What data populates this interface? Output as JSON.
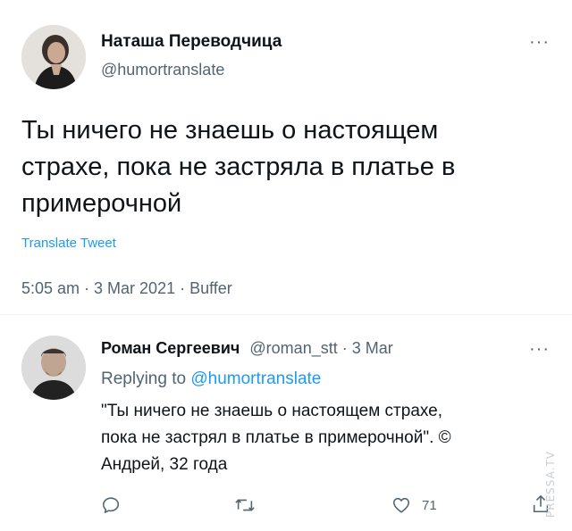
{
  "main_tweet": {
    "display_name": "Наташа Переводчица",
    "handle": "@humortranslate",
    "more_icon": "ellipsis-icon",
    "text_lines": [
      "Ты ничего не знаешь о настоящем",
      "страхе, пока не застряла в платье в",
      "примерочной"
    ],
    "translate_label": "Translate Tweet",
    "timestamp": "5:05 am · 3 Mar 2021 · Buffer"
  },
  "reply": {
    "display_name": "Роман Сергеевич",
    "handle_date": "@roman_stt · 3 Mar",
    "replying_prefix": "Replying to",
    "replying_handle": "@humortranslate",
    "text_lines": [
      "\"Ты ничего не знаешь о настоящем страхе,",
      "пока не застрял в платье в примерочной\". ©",
      "Андрей, 32 года"
    ],
    "actions": {
      "reply_icon": "reply-icon",
      "retweet_icon": "retweet-icon",
      "like_icon": "heart-icon",
      "like_count": "71",
      "share_icon": "share-icon"
    }
  },
  "watermark": "PRESSA.TV",
  "colors": {
    "link": "#1d9bf0",
    "secondary_text": "#536471",
    "primary_text": "#0f1419",
    "divider": "#eff3f4"
  }
}
